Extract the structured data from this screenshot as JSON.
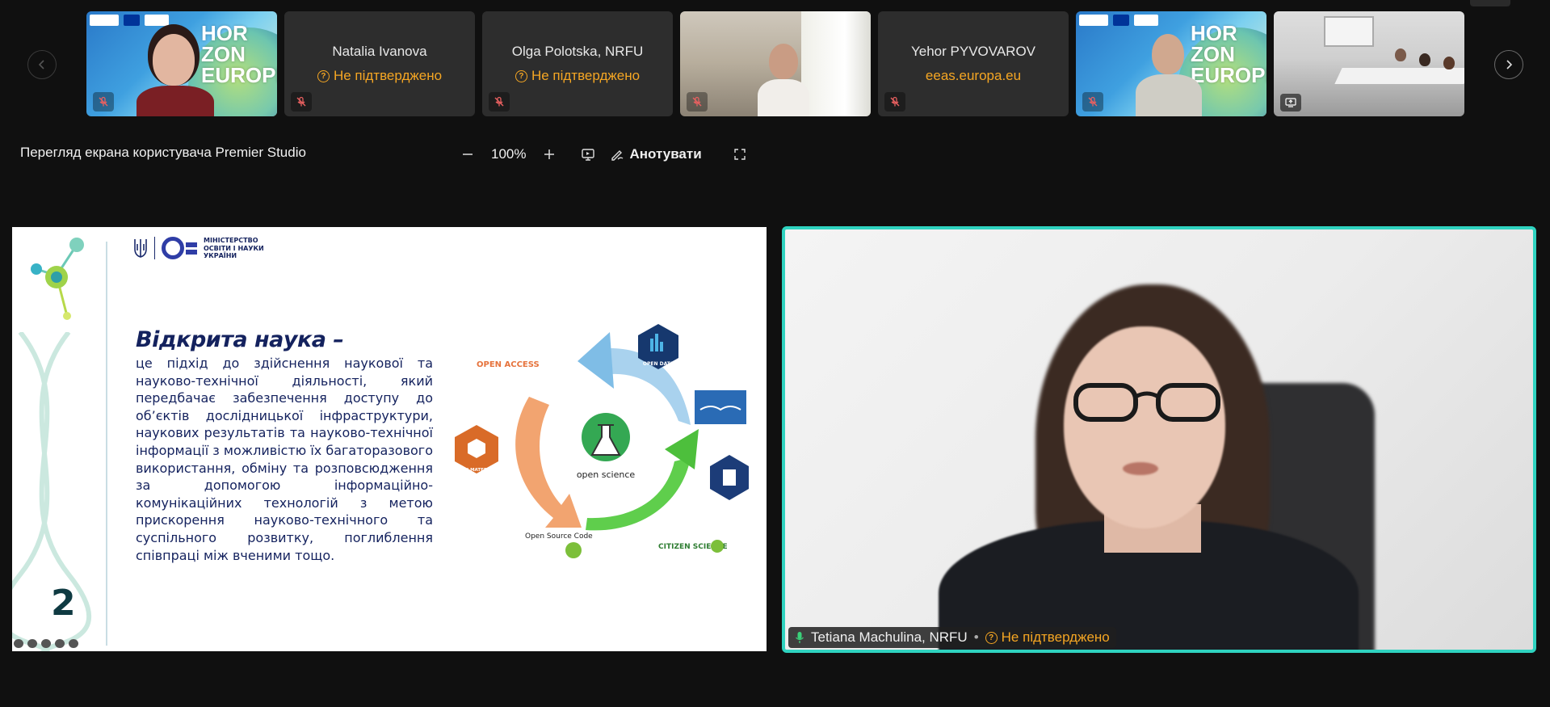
{
  "participants": [
    {
      "name": "",
      "status": ""
    },
    {
      "name": "Natalia Ivanova",
      "status": "Не підтверджено"
    },
    {
      "name": "Olga Polotska, NRFU",
      "status": "Не підтверджено"
    },
    {
      "name": "",
      "status": ""
    },
    {
      "name": "Yehor PYVOVAROV",
      "status": "eeas.europa.eu"
    },
    {
      "name": "",
      "status": ""
    },
    {
      "name": "",
      "status": ""
    }
  ],
  "horizon_text": "HOR ZON EUROPE",
  "toolbar": {
    "share_title": "Перегляд екрана користувача Premier Studio",
    "zoom": "100%",
    "annotate_label": "Анотувати"
  },
  "slide": {
    "ministry_text": [
      "МІНІСТЕРСТВО",
      "ОСВІТИ І НАУКИ",
      "УКРАЇНИ"
    ],
    "heading": "Відкрита наука –",
    "body": "це підхід до здійснення наукової та науково-технічної діяльності, який передбачає забезпечення доступу до об’єктів дослідницької інфраструктури, наукових результатів та науково-технічної інформації з можливістю їх багаторазового використання, обміну та розповсюдження за допомогою інформаційно-комунікаційних технологій з метою прискорення науково-технічного та суспільного розвитку, поглиблення співпраці між вченими тощо.",
    "number": "2",
    "graphic_labels": {
      "open_access": "OPEN ACCESS",
      "open_data": "OPEN DATA",
      "open_materials": "OPEN MATERIALS",
      "open_science": "open science",
      "open_source": "Open Source Code",
      "citizen": "CITIZEN SCIENCE"
    }
  },
  "speaker": {
    "name": "Tetiana Machulina, NRFU",
    "status": "Не підтверджено"
  },
  "colors": {
    "accent_border": "#2fd3c0",
    "status_orange": "#f5a623",
    "slide_navy": "#14225e"
  }
}
